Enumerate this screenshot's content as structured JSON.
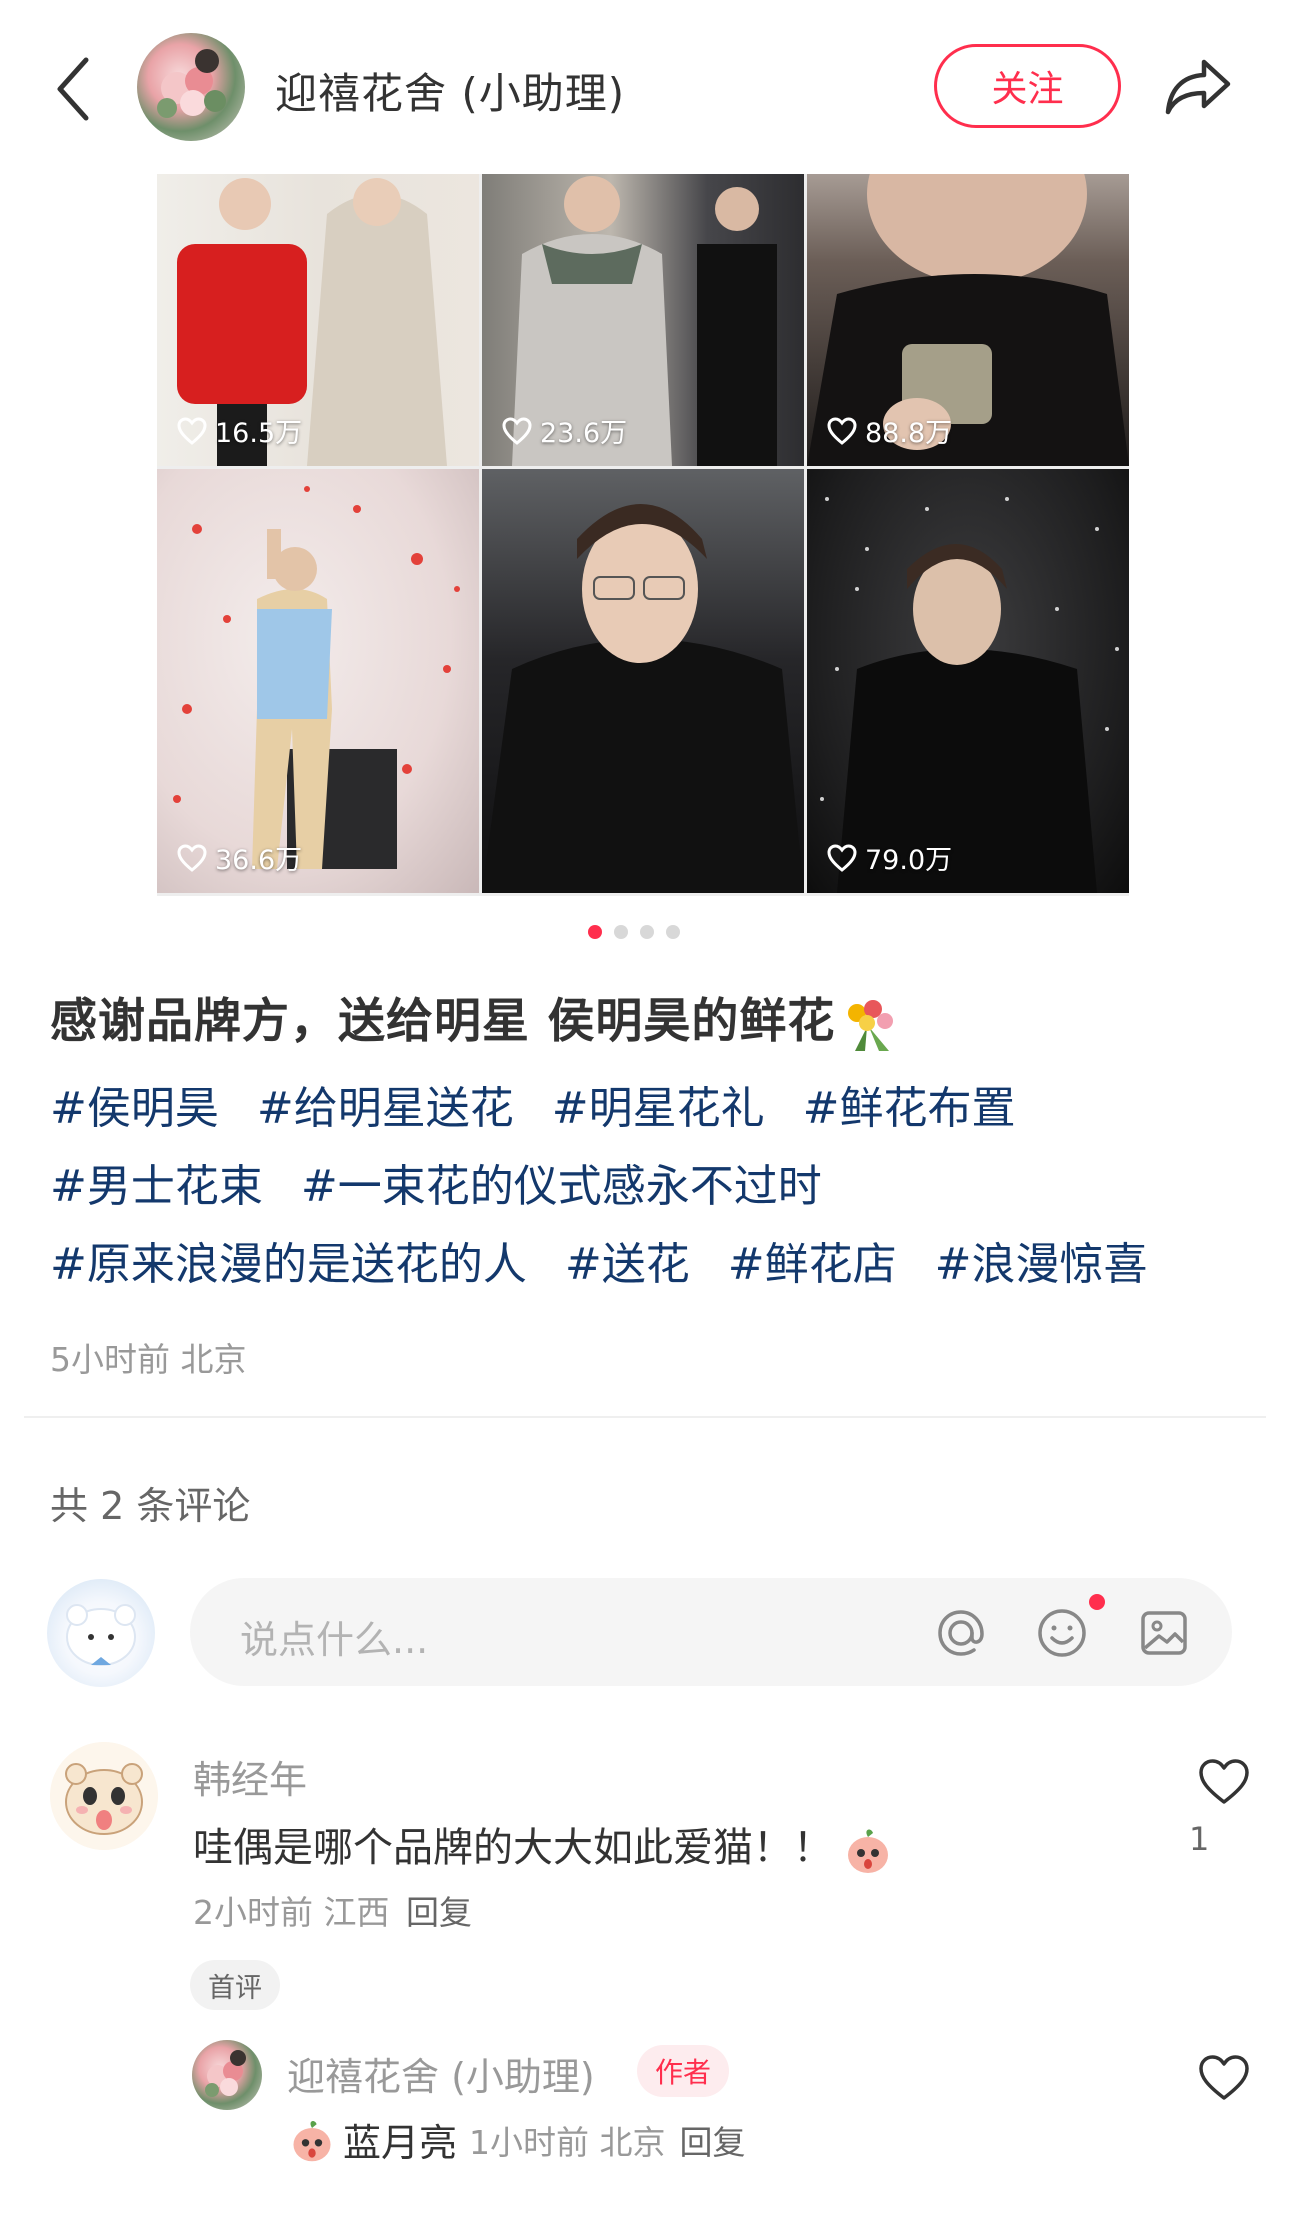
{
  "header": {
    "author_name": "迎禧花舍 (小助理)",
    "follow_label": "关注"
  },
  "grid": {
    "items": [
      {
        "likes": "16.5万"
      },
      {
        "likes": "23.6万"
      },
      {
        "likes": "88.8万"
      },
      {
        "likes": "36.6万"
      },
      {
        "likes": ""
      },
      {
        "likes": "79.0万"
      }
    ]
  },
  "carousel": {
    "total": 4,
    "active_index": 0
  },
  "post": {
    "title": "感谢品牌方，送给明星 侯明昊的鲜花",
    "tags": [
      "#侯明昊",
      "#给明星送花",
      "#明星花礼",
      "#鲜花布置",
      "#男士花束",
      "#一束花的仪式感永不过时",
      "#原来浪漫的是送花的人",
      "#送花",
      "#鲜花店",
      "#浪漫惊喜"
    ],
    "meta": "5小时前 北京"
  },
  "comments_section": {
    "count_label": "共 2 条评论",
    "input_placeholder": "说点什么...",
    "comments": [
      {
        "user": "韩经年",
        "text": "哇偶是哪个品牌的大大如此爱猫！！",
        "meta": "2小时前 江西",
        "reply_label": "回复",
        "like_count": "1",
        "badge": "首评",
        "replies": [
          {
            "user": "迎禧花舍 (小助理)",
            "badge": "作者",
            "text": "蓝月亮",
            "meta": "1小时前 北京",
            "reply_label": "回复"
          }
        ]
      }
    ]
  },
  "colors": {
    "accent": "#ff2e4d",
    "tag": "#13386c",
    "muted": "#999999"
  }
}
